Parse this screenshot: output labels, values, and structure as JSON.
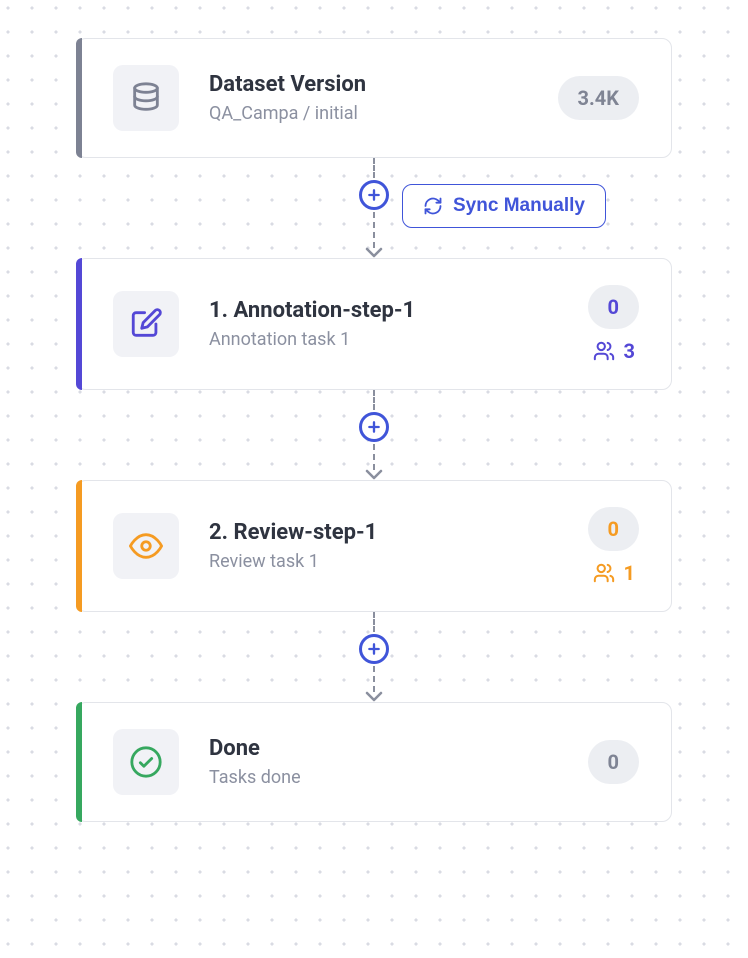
{
  "sync_button_label": "Sync Manually",
  "colors": {
    "gray": "#7d8293",
    "purple": "#5448d6",
    "orange": "#f59b22",
    "green": "#36a85f",
    "blue": "#4055d9"
  },
  "nodes": [
    {
      "kind": "dataset",
      "title": "Dataset Version",
      "subtitle": "QA_Campa / initial",
      "count_label": "3.4K",
      "people_count": null,
      "stripe": "gray",
      "icon": "database"
    },
    {
      "kind": "annotation",
      "title": "1. Annotation-step-1",
      "subtitle": "Annotation task 1",
      "count_label": "0",
      "people_count": "3",
      "stripe": "purple",
      "icon": "edit"
    },
    {
      "kind": "review",
      "title": "2. Review-step-1",
      "subtitle": "Review task 1",
      "count_label": "0",
      "people_count": "1",
      "stripe": "orange",
      "icon": "eye"
    },
    {
      "kind": "done",
      "title": "Done",
      "subtitle": "Tasks done",
      "count_label": "0",
      "people_count": null,
      "stripe": "green",
      "icon": "check"
    }
  ]
}
